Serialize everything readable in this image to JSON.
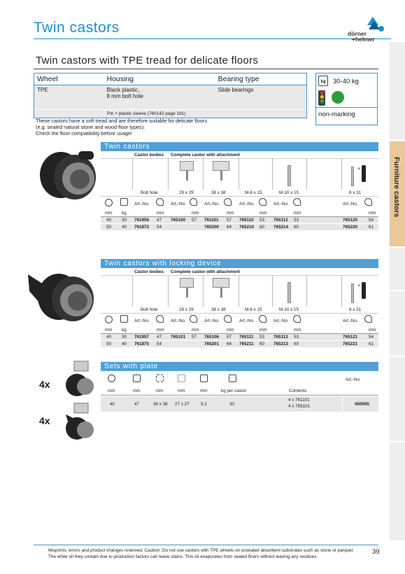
{
  "page": {
    "title": "Twin castors",
    "number": "39"
  },
  "logo": {
    "line1": "dörner",
    "line2": "+helmer"
  },
  "side_tab": {
    "label": "Furniture castors"
  },
  "subtitle": "Twin castors with TPE tread for delicate floors",
  "main_table": {
    "headers": [
      "Wheel",
      "Housing",
      "Bearing type"
    ],
    "row": {
      "wheel": "TPE",
      "housing_line1": "Black plastic,",
      "housing_line2": "8 mm bolt hole",
      "bearing": "Slide bearings"
    },
    "note": "Pin + plastic sleeve (760142 page 181)"
  },
  "infobox": {
    "load": "30-40 kg",
    "marking": "non-marking"
  },
  "description": [
    "These castors have a soft tread and are therefore suitable for delicate floors",
    "(e.g. sealed natural stone and wood floor types).",
    "Check the floor compatibility before usage!"
  ],
  "sections": [
    {
      "title": "Twin castors",
      "bodies_label": "Castor bodies",
      "complete_label": "Complete castor with attachment",
      "col_heads": [
        "Bolt hole",
        "29 x 29",
        "38 x 38",
        "M-8 x 15",
        "M-10 x 15",
        "8 x 31"
      ],
      "artno": "Art.-No.",
      "units": [
        "mm",
        "kg",
        "mm",
        "mm",
        "mm",
        "mm",
        "mm",
        "mm"
      ],
      "rows": [
        [
          "40",
          "30",
          "761956",
          "47",
          "765100",
          "57",
          "761101",
          "57",
          "765110",
          "53",
          "765112",
          "53",
          "765120",
          "54"
        ],
        [
          "50",
          "40",
          "761872",
          "54",
          "",
          "",
          "765200",
          "64",
          "765210",
          "60",
          "765214",
          "60",
          "765220",
          "61"
        ]
      ]
    },
    {
      "title": "Twin castors with locking device",
      "bodies_label": "Castor bodies",
      "complete_label": "Complete castor with attachment",
      "col_heads": [
        "Bolt hole",
        "29 x 29",
        "38 x 38",
        "M-8 x 15",
        "M-10 x 15",
        "8 x 31"
      ],
      "artno": "Art.-No.",
      "units": [
        "mm",
        "kg",
        "mm",
        "mm",
        "mm",
        "mm",
        "mm",
        "mm"
      ],
      "rows": [
        [
          "40",
          "30",
          "761957",
          "47",
          "765101",
          "57",
          "765106",
          "57",
          "765111",
          "53",
          "765113",
          "53",
          "765121",
          "54"
        ],
        [
          "50",
          "40",
          "761875",
          "54",
          "",
          "",
          "765201",
          "64",
          "765211",
          "60",
          "765213",
          "60",
          "765221",
          "61"
        ]
      ]
    }
  ],
  "sets": {
    "title": "Sets with plate",
    "artno": "Art.-No.",
    "units": [
      "mm",
      "mm",
      "mm",
      "mm",
      "mm",
      "kg per castor",
      "Contents"
    ],
    "row": [
      "40",
      "47",
      "38 x 38",
      "27 x 27",
      "5.2",
      "30"
    ],
    "contents": [
      "4 x 761101",
      "4 x 765101"
    ],
    "article": "450005",
    "mult": [
      "4x",
      "4x"
    ]
  },
  "footer": [
    "Misprints, errors and product changes reserved. Caution: Do not use castors with TPE wheels on unsealed absorbent substrates such as stone or parquet.",
    "The white oil they contain due to production factors can leave stains. This oil evaporates from sealed floors without leaving any residues."
  ],
  "colors": {
    "accent": "#1b8fd0",
    "section": "#4fa0d8",
    "tab": "#e9c89a"
  }
}
